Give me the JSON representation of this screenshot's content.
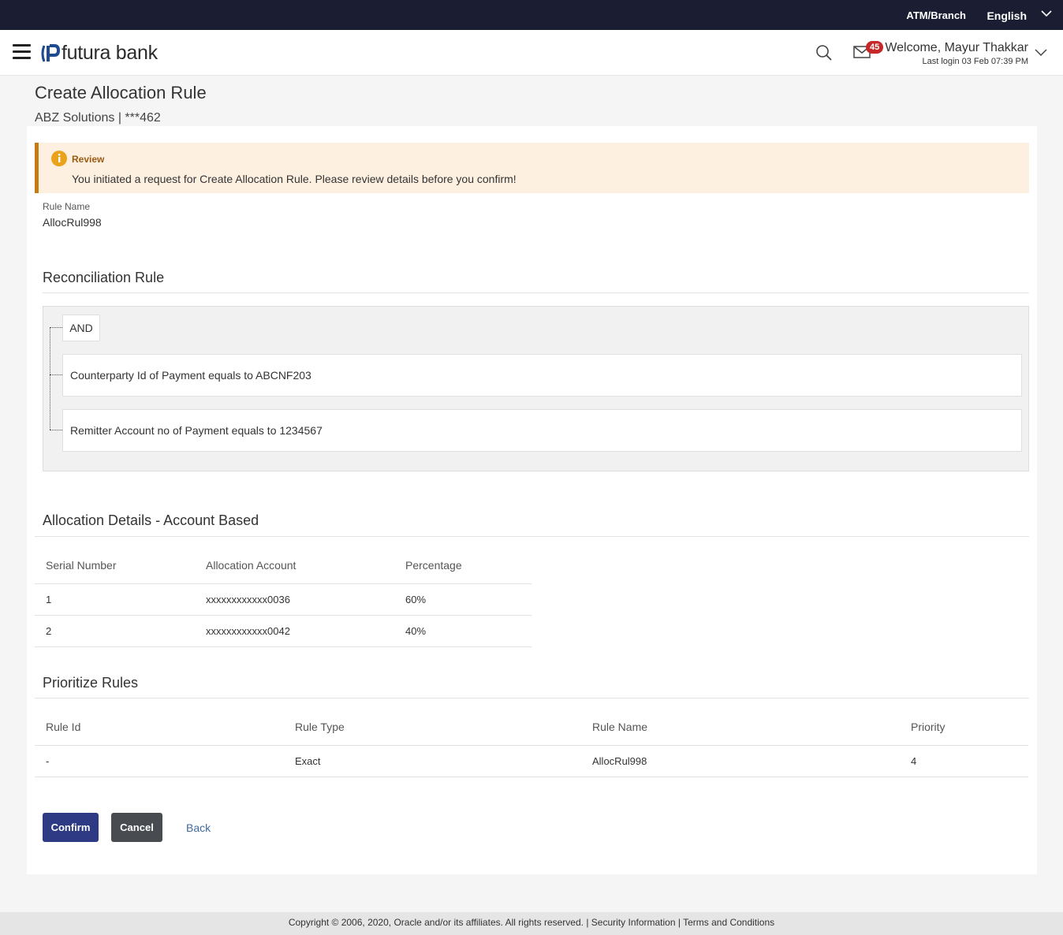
{
  "topbar": {
    "atm_branch": "ATM/Branch",
    "language": "English"
  },
  "header": {
    "brand": "futura bank",
    "notification_count": "45",
    "welcome": "Welcome, Mayur Thakkar",
    "last_login": "Last login 03 Feb 07:39 PM"
  },
  "page": {
    "title": "Create Allocation Rule",
    "subtitle": "ABZ Solutions | ***462"
  },
  "review": {
    "title": "Review",
    "message": "You initiated a request for Create Allocation Rule. Please review details before you confirm!"
  },
  "rule_name": {
    "label": "Rule Name",
    "value": "AllocRul998"
  },
  "reconciliation": {
    "title": "Reconciliation Rule",
    "operator": "AND",
    "conditions": [
      "Counterparty Id of Payment equals to ABCNF203",
      "Remitter Account no of Payment equals to 1234567"
    ]
  },
  "allocation": {
    "title": "Allocation Details - Account Based",
    "headers": [
      "Serial Number",
      "Allocation Account",
      "Percentage"
    ],
    "rows": [
      [
        "1",
        "xxxxxxxxxxxx0036",
        "60%"
      ],
      [
        "2",
        "xxxxxxxxxxxx0042",
        "40%"
      ]
    ]
  },
  "prioritize": {
    "title": "Prioritize Rules",
    "headers": [
      "Rule Id",
      "Rule Type",
      "Rule Name",
      "Priority"
    ],
    "rows": [
      [
        "-",
        "Exact",
        "AllocRul998",
        "4"
      ]
    ]
  },
  "actions": {
    "confirm": "Confirm",
    "cancel": "Cancel",
    "back": "Back"
  },
  "footer": {
    "copyright": "Copyright © 2006, 2020, Oracle and/or its affiliates. All rights reserved.",
    "separator": " | ",
    "security": "Security Information",
    "terms": "Terms and Conditions"
  },
  "colors": {
    "topbar": "#1b1e33",
    "primary": "#2e3a84",
    "warning": "#c67a15",
    "badge": "#c62828"
  }
}
